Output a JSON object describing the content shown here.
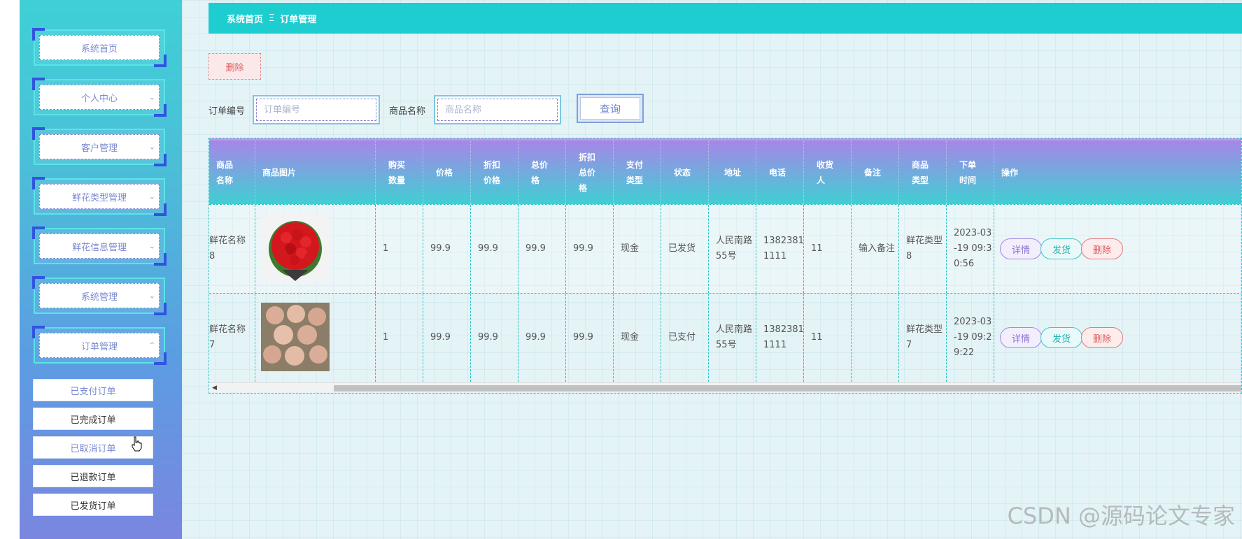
{
  "breadcrumb": {
    "home": "系统首页",
    "separator": "Ξ",
    "current": "订单管理"
  },
  "sidebar": {
    "items": [
      {
        "label": "系统首页",
        "chevron": ""
      },
      {
        "label": "个人中心",
        "chevron": "⌄"
      },
      {
        "label": "客户管理",
        "chevron": "⌄"
      },
      {
        "label": "鲜花类型管理",
        "chevron": "⌄"
      },
      {
        "label": "鲜花信息管理",
        "chevron": "⌄"
      },
      {
        "label": "系统管理",
        "chevron": "⌄"
      },
      {
        "label": "订单管理",
        "chevron": "⌃"
      }
    ],
    "sub_items": [
      {
        "label": "已支付订单"
      },
      {
        "label": "已完成订单"
      },
      {
        "label": "已取消订单"
      },
      {
        "label": "已退款订单"
      },
      {
        "label": "已发货订单"
      }
    ]
  },
  "toolbar": {
    "delete_label": "删除"
  },
  "search": {
    "order_no_label": "订单编号",
    "order_no_placeholder": "订单编号",
    "order_no_value": "",
    "product_label": "商品名称",
    "product_placeholder": "商品名称",
    "product_value": "",
    "query_label": "查询"
  },
  "table": {
    "headers": [
      "商品\n名称",
      "商品图片",
      "购买\n数量",
      "价格",
      "折扣\n价格",
      "总价\n格",
      "折扣\n总价\n格",
      "支付\n类型",
      "状态",
      "地址",
      "电话",
      "收货\n人",
      "备注",
      "商品\n类型",
      "下单\n时间",
      "操作"
    ],
    "rows": [
      {
        "name": "鲜花名称\n8",
        "image": "red-rose-bouquet",
        "qty": "1",
        "price": "99.9",
        "discount_price": "99.9",
        "total": "99.9",
        "discount_total": "99.9",
        "pay_type": "现金",
        "status": "已发货",
        "address": "人民南路\n55号",
        "phone": "1382381\n1111",
        "receiver": "11",
        "remark": "输入备注",
        "category": "鲜花类型\n8",
        "time": "2023-03\n-19 09:3\n0:56"
      },
      {
        "name": "鲜花名称\n7",
        "image": "champagne-rose-bouquet",
        "qty": "1",
        "price": "99.9",
        "discount_price": "99.9",
        "total": "99.9",
        "discount_total": "99.9",
        "pay_type": "现金",
        "status": "已支付",
        "address": "人民南路\n55号",
        "phone": "1382381\n1111",
        "receiver": "11",
        "remark": "",
        "category": "鲜花类型\n7",
        "time": "2023-03\n-19 09:2\n9:22"
      }
    ],
    "actions": {
      "detail": "详情",
      "ship": "发货",
      "delete": "删除"
    }
  },
  "watermark": "CSDN @源码论文专家",
  "colors": {
    "topbar": "#1ecdd0",
    "accent_blue": "#2f55e0",
    "header_gradient_top": "#a686e8",
    "header_gradient_bottom": "#3fcfd3",
    "delete_red": "#de5959",
    "ship_teal": "#23b2b4",
    "detail_purple": "#8e6fd6"
  }
}
